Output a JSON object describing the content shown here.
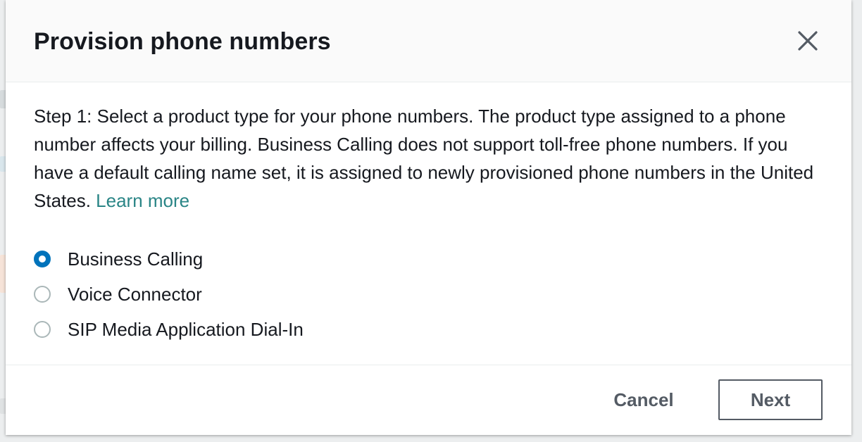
{
  "modal": {
    "title": "Provision phone numbers",
    "close_icon": "close-icon",
    "description": "Step 1: Select a product type for your phone numbers. The product type assigned to a phone number affects your billing. Business Calling does not support toll-free phone numbers. If you have a default calling name set, it is assigned to newly provisioned phone numbers in the United States.",
    "learn_more": "Learn more",
    "options": [
      {
        "label": "Business Calling",
        "selected": true
      },
      {
        "label": "Voice Connector",
        "selected": false
      },
      {
        "label": "SIP Media Application Dial-In",
        "selected": false
      }
    ],
    "footer": {
      "cancel_label": "Cancel",
      "next_label": "Next"
    }
  },
  "colors": {
    "accent": "#0073bb",
    "link": "#2a8586",
    "text": "#16191f",
    "button_text": "#545b64"
  }
}
